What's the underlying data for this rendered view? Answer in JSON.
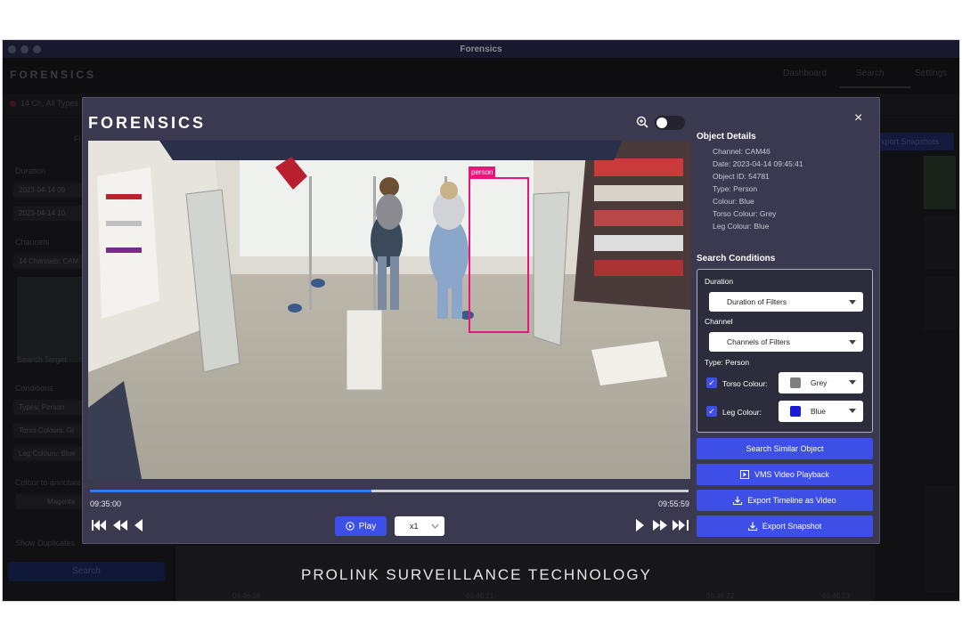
{
  "window": {
    "title": "Forensics"
  },
  "background": {
    "logo": "FORENSICS",
    "nav": [
      "Dashboard",
      "Search",
      "Settings"
    ],
    "filter_summary": "14 Ch, All Types",
    "left_labels": {
      "filter": "Fi",
      "duration": "Duration",
      "date1": "2023-04-14 09",
      "date2": "2023-04-14 10",
      "channels": "Channels",
      "channels_value": "14 Channels: CAM",
      "search_target": "Search Target",
      "conditions": "Conditions",
      "types": "Types: Person",
      "torso": "Torso Colours: Gr",
      "legs": "Leg Colours: Blue",
      "colour_annotate": "Colour to annotate",
      "colour_value": "Magenta",
      "show_duplicates": "Show Duplicates",
      "search_button": "Search"
    },
    "export_snapshots": "xport Snapshots",
    "bottom_times": [
      "09:46:08",
      "09:46:21",
      "09:46:22",
      "09:46:23"
    ]
  },
  "modal": {
    "logo": "FORENSICS",
    "close": "×",
    "video": {
      "detection_label": "person",
      "progress": 0.47,
      "time_start": "09:35:00",
      "time_end": "09:55:59"
    },
    "controls": {
      "play_label": "Play",
      "speed": "x1"
    },
    "object_details": {
      "title": "Object Details",
      "lines": [
        "Channel: CAM46",
        "Date: 2023-04-14 09:45:41",
        "Object ID: 54781",
        "Type: Person",
        "Colour: Blue",
        "Torso Colour: Grey",
        "Leg Colour: Blue"
      ]
    },
    "search_conditions": {
      "title": "Search Conditions",
      "duration_label": "Duration",
      "duration_value": "Duration of Filters",
      "channel_label": "Channel",
      "channel_value": "Channels of Filters",
      "type_label": "Type: Person",
      "torso_label": "Torso Colour:",
      "torso_value": "Grey",
      "torso_color": "#7f7f7f",
      "leg_label": "Leg Colour:",
      "leg_value": "Blue",
      "leg_color": "#1a1adb"
    },
    "actions": {
      "search_similar": "Search Similar Object",
      "vms_playback": "VMS Video Playback",
      "export_timeline": "Export Timeline as Video",
      "export_snapshot": "Export Snapshot"
    }
  },
  "footer": {
    "brand": "PROLINK SURVEILLANCE TECHNOLOGY"
  },
  "colors": {
    "accent": "#3d4fe6",
    "detection": "#e8157a",
    "progress": "#2e7be8"
  }
}
